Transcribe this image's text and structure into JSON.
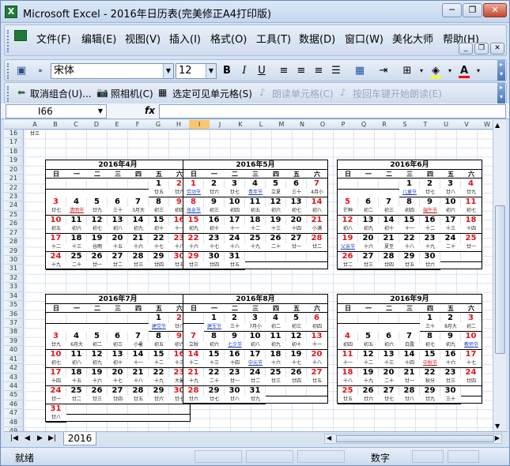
{
  "window": {
    "title": "Microsoft Excel - 2016年日历表(完美修正A4打印版)",
    "icon": "excel-icon"
  },
  "menu": [
    "文件(F)",
    "编辑(E)",
    "视图(V)",
    "插入(I)",
    "格式(O)",
    "工具(T)",
    "数据(D)",
    "窗口(W)",
    "美化大师",
    "帮助(H)"
  ],
  "toolbar": {
    "font": "宋体",
    "size": "12",
    "bold": "B",
    "italic": "I",
    "underline": "U",
    "fill_color": "#ffff00",
    "font_color": "#ff0000"
  },
  "toolbar2": {
    "cancel_group": "取消组合(U)...",
    "camera": "照相机(C)",
    "select_visible": "选定可见单元格(S)",
    "read_cell": "朗读单元格(C)",
    "read_enter": "按回车键开始朗读(E)"
  },
  "formula": {
    "namebox": "I66",
    "fx": "fx",
    "value": ""
  },
  "columns": [
    "A",
    "B",
    "C",
    "D",
    "E",
    "F",
    "G",
    "H",
    "I",
    "J",
    "K",
    "L",
    "M",
    "N",
    "O",
    "P",
    "Q",
    "R",
    "S",
    "T",
    "U",
    "V",
    "W"
  ],
  "selected_column": "I",
  "rows": [
    "16",
    "17",
    "18",
    "19",
    "20",
    "21",
    "22",
    "23",
    "24",
    "25",
    "26",
    "27",
    "28",
    "29",
    "30",
    "31",
    "32",
    "33",
    "34",
    "35",
    "36",
    "37",
    "38",
    "39",
    "40",
    "41",
    "42",
    "43",
    "44",
    "45",
    "46",
    "47",
    "48",
    "49"
  ],
  "top_lunar": "廿三",
  "weekdays": [
    "日",
    "一",
    "二",
    "三",
    "四",
    "五",
    "六"
  ],
  "calendars": [
    {
      "title": "2016年4月",
      "weeks": [
        [
          "",
          "",
          "",
          "",
          "",
          "1",
          "2"
        ],
        [
          "3",
          "4",
          "5",
          "6",
          "7",
          "8",
          "9"
        ],
        [
          "10",
          "11",
          "12",
          "13",
          "14",
          "15",
          "16"
        ],
        [
          "17",
          "18",
          "19",
          "20",
          "21",
          "22",
          "23"
        ],
        [
          "24",
          "25",
          "26",
          "27",
          "28",
          "29",
          "30"
        ]
      ],
      "lunar": [
        [
          "",
          "",
          "",
          "",
          "",
          "廿五",
          "廿六"
        ],
        [
          "廿七",
          "清明节",
          "廿九",
          "三十",
          "3月大",
          "初三",
          "初四"
        ],
        [
          "初五",
          "初六",
          "初七",
          "初八",
          "初九",
          "初十",
          "十一"
        ],
        [
          "十二",
          "十三",
          "谷雨",
          "十五",
          "十六",
          "十七",
          "十八"
        ],
        [
          "十九",
          "二十",
          "廿一",
          "廿二",
          "廿三",
          "廿四",
          "廿五"
        ]
      ]
    },
    {
      "title": "2016年5月",
      "weeks": [
        [
          "1",
          "2",
          "3",
          "4",
          "5",
          "6",
          "7"
        ],
        [
          "8",
          "9",
          "10",
          "11",
          "12",
          "13",
          "14"
        ],
        [
          "15",
          "16",
          "17",
          "18",
          "19",
          "20",
          "21"
        ],
        [
          "22",
          "23",
          "24",
          "25",
          "26",
          "27",
          "28"
        ],
        [
          "29",
          "30",
          "31",
          "",
          "",
          "",
          ""
        ]
      ],
      "lunar": [
        [
          "劳动节",
          "廿六",
          "廿七",
          "青年节",
          "立夏",
          "三十",
          "4月小"
        ],
        [
          "母亲节",
          "初三",
          "初四",
          "初五",
          "初六",
          "初七",
          "初八"
        ],
        [
          "初九",
          "初十",
          "十一",
          "十二",
          "十三",
          "十四",
          "小满"
        ],
        [
          "十六",
          "十七",
          "十八",
          "十九",
          "二十",
          "廿一",
          "廿二"
        ],
        [
          "廿三",
          "廿四",
          "廿五",
          "",
          "",
          "",
          ""
        ]
      ]
    },
    {
      "title": "2016年6月",
      "weeks": [
        [
          "",
          "",
          "",
          "1",
          "2",
          "3",
          "4"
        ],
        [
          "5",
          "6",
          "7",
          "8",
          "9",
          "10",
          "11"
        ],
        [
          "12",
          "13",
          "14",
          "15",
          "16",
          "17",
          "18"
        ],
        [
          "19",
          "20",
          "21",
          "22",
          "23",
          "24",
          "25"
        ],
        [
          "26",
          "27",
          "28",
          "29",
          "30",
          "",
          ""
        ]
      ],
      "lunar": [
        [
          "",
          "",
          "",
          "儿童节",
          "廿七",
          "廿八",
          "廿九"
        ],
        [
          "芒种",
          "初二",
          "初三",
          "初四",
          "端午节",
          "初六",
          "初七"
        ],
        [
          "初八",
          "初九",
          "初十",
          "十一",
          "十二",
          "十三",
          "十四"
        ],
        [
          "父亲节",
          "十六",
          "夏至",
          "十八",
          "十九",
          "二十",
          "廿一"
        ],
        [
          "廿二",
          "廿三",
          "廿四",
          "廿五",
          "廿六",
          "",
          ""
        ]
      ]
    },
    {
      "title": "2016年7月",
      "weeks": [
        [
          "",
          "",
          "",
          "",
          "",
          "1",
          "2"
        ],
        [
          "3",
          "4",
          "5",
          "6",
          "7",
          "8",
          "9"
        ],
        [
          "10",
          "11",
          "12",
          "13",
          "14",
          "15",
          "16"
        ],
        [
          "17",
          "18",
          "19",
          "20",
          "21",
          "22",
          "23"
        ],
        [
          "24",
          "25",
          "26",
          "27",
          "28",
          "29",
          "30"
        ],
        [
          "31",
          "",
          "",
          "",
          "",
          "",
          ""
        ]
      ],
      "lunar": [
        [
          "",
          "",
          "",
          "",
          "",
          "建党节",
          "廿八"
        ],
        [
          "廿九",
          "6月大",
          "初二",
          "初三",
          "小暑",
          "初五",
          "初六"
        ],
        [
          "初七",
          "初八",
          "初九",
          "初十",
          "十一",
          "十二",
          "十三"
        ],
        [
          "十四",
          "十五",
          "十六",
          "十七",
          "十八",
          "十九",
          "大暑"
        ],
        [
          "廿一",
          "廿二",
          "廿三",
          "廿四",
          "廿五",
          "廿六",
          "廿七"
        ],
        [
          "廿八",
          "",
          "",
          "",
          "",
          "",
          ""
        ]
      ]
    },
    {
      "title": "2016年8月",
      "weeks": [
        [
          "",
          "1",
          "2",
          "3",
          "4",
          "5",
          "6"
        ],
        [
          "7",
          "8",
          "9",
          "10",
          "11",
          "12",
          "13"
        ],
        [
          "14",
          "15",
          "16",
          "17",
          "18",
          "19",
          "20"
        ],
        [
          "21",
          "22",
          "23",
          "24",
          "25",
          "26",
          "27"
        ],
        [
          "28",
          "29",
          "30",
          "31",
          "",
          "",
          ""
        ]
      ],
      "lunar": [
        [
          "",
          "建军节",
          "三十",
          "7月小",
          "初二",
          "初三",
          "初四"
        ],
        [
          "立秋",
          "初六",
          "七夕节",
          "初八",
          "初九",
          "初十",
          "十一"
        ],
        [
          "十二",
          "十三",
          "十四",
          "中元节",
          "十六",
          "十七",
          "十八"
        ],
        [
          "十九",
          "二十",
          "廿一",
          "廿二",
          "廿三",
          "廿四",
          "廿五"
        ],
        [
          "廿六",
          "廿七",
          "廿八",
          "廿九",
          "",
          "",
          ""
        ]
      ]
    },
    {
      "title": "2016年9月",
      "weeks": [
        [
          "",
          "",
          "",
          "",
          "1",
          "2",
          "3"
        ],
        [
          "4",
          "5",
          "6",
          "7",
          "8",
          "9",
          "10"
        ],
        [
          "11",
          "12",
          "13",
          "14",
          "15",
          "16",
          "17"
        ],
        [
          "18",
          "19",
          "20",
          "21",
          "22",
          "23",
          "24"
        ],
        [
          "25",
          "26",
          "27",
          "28",
          "29",
          "30",
          ""
        ]
      ],
      "lunar": [
        [
          "",
          "",
          "",
          "",
          "三十",
          "8月大",
          "初二"
        ],
        [
          "初四",
          "初五",
          "初六",
          "白露",
          "初七",
          "初九",
          "教师节"
        ],
        [
          "十一",
          "十二",
          "十三",
          "十四",
          "中秋节",
          "十六",
          "十七"
        ],
        [
          "十八",
          "十九",
          "二十",
          "廿一",
          "秋分",
          "廿三",
          "廿四"
        ],
        [
          "廿五",
          "廿六",
          "廿七",
          "廿八",
          "廿九",
          "三十",
          ""
        ]
      ]
    }
  ],
  "sheet_tab": "2016",
  "status": {
    "ready": "就绪",
    "num": "数字"
  }
}
